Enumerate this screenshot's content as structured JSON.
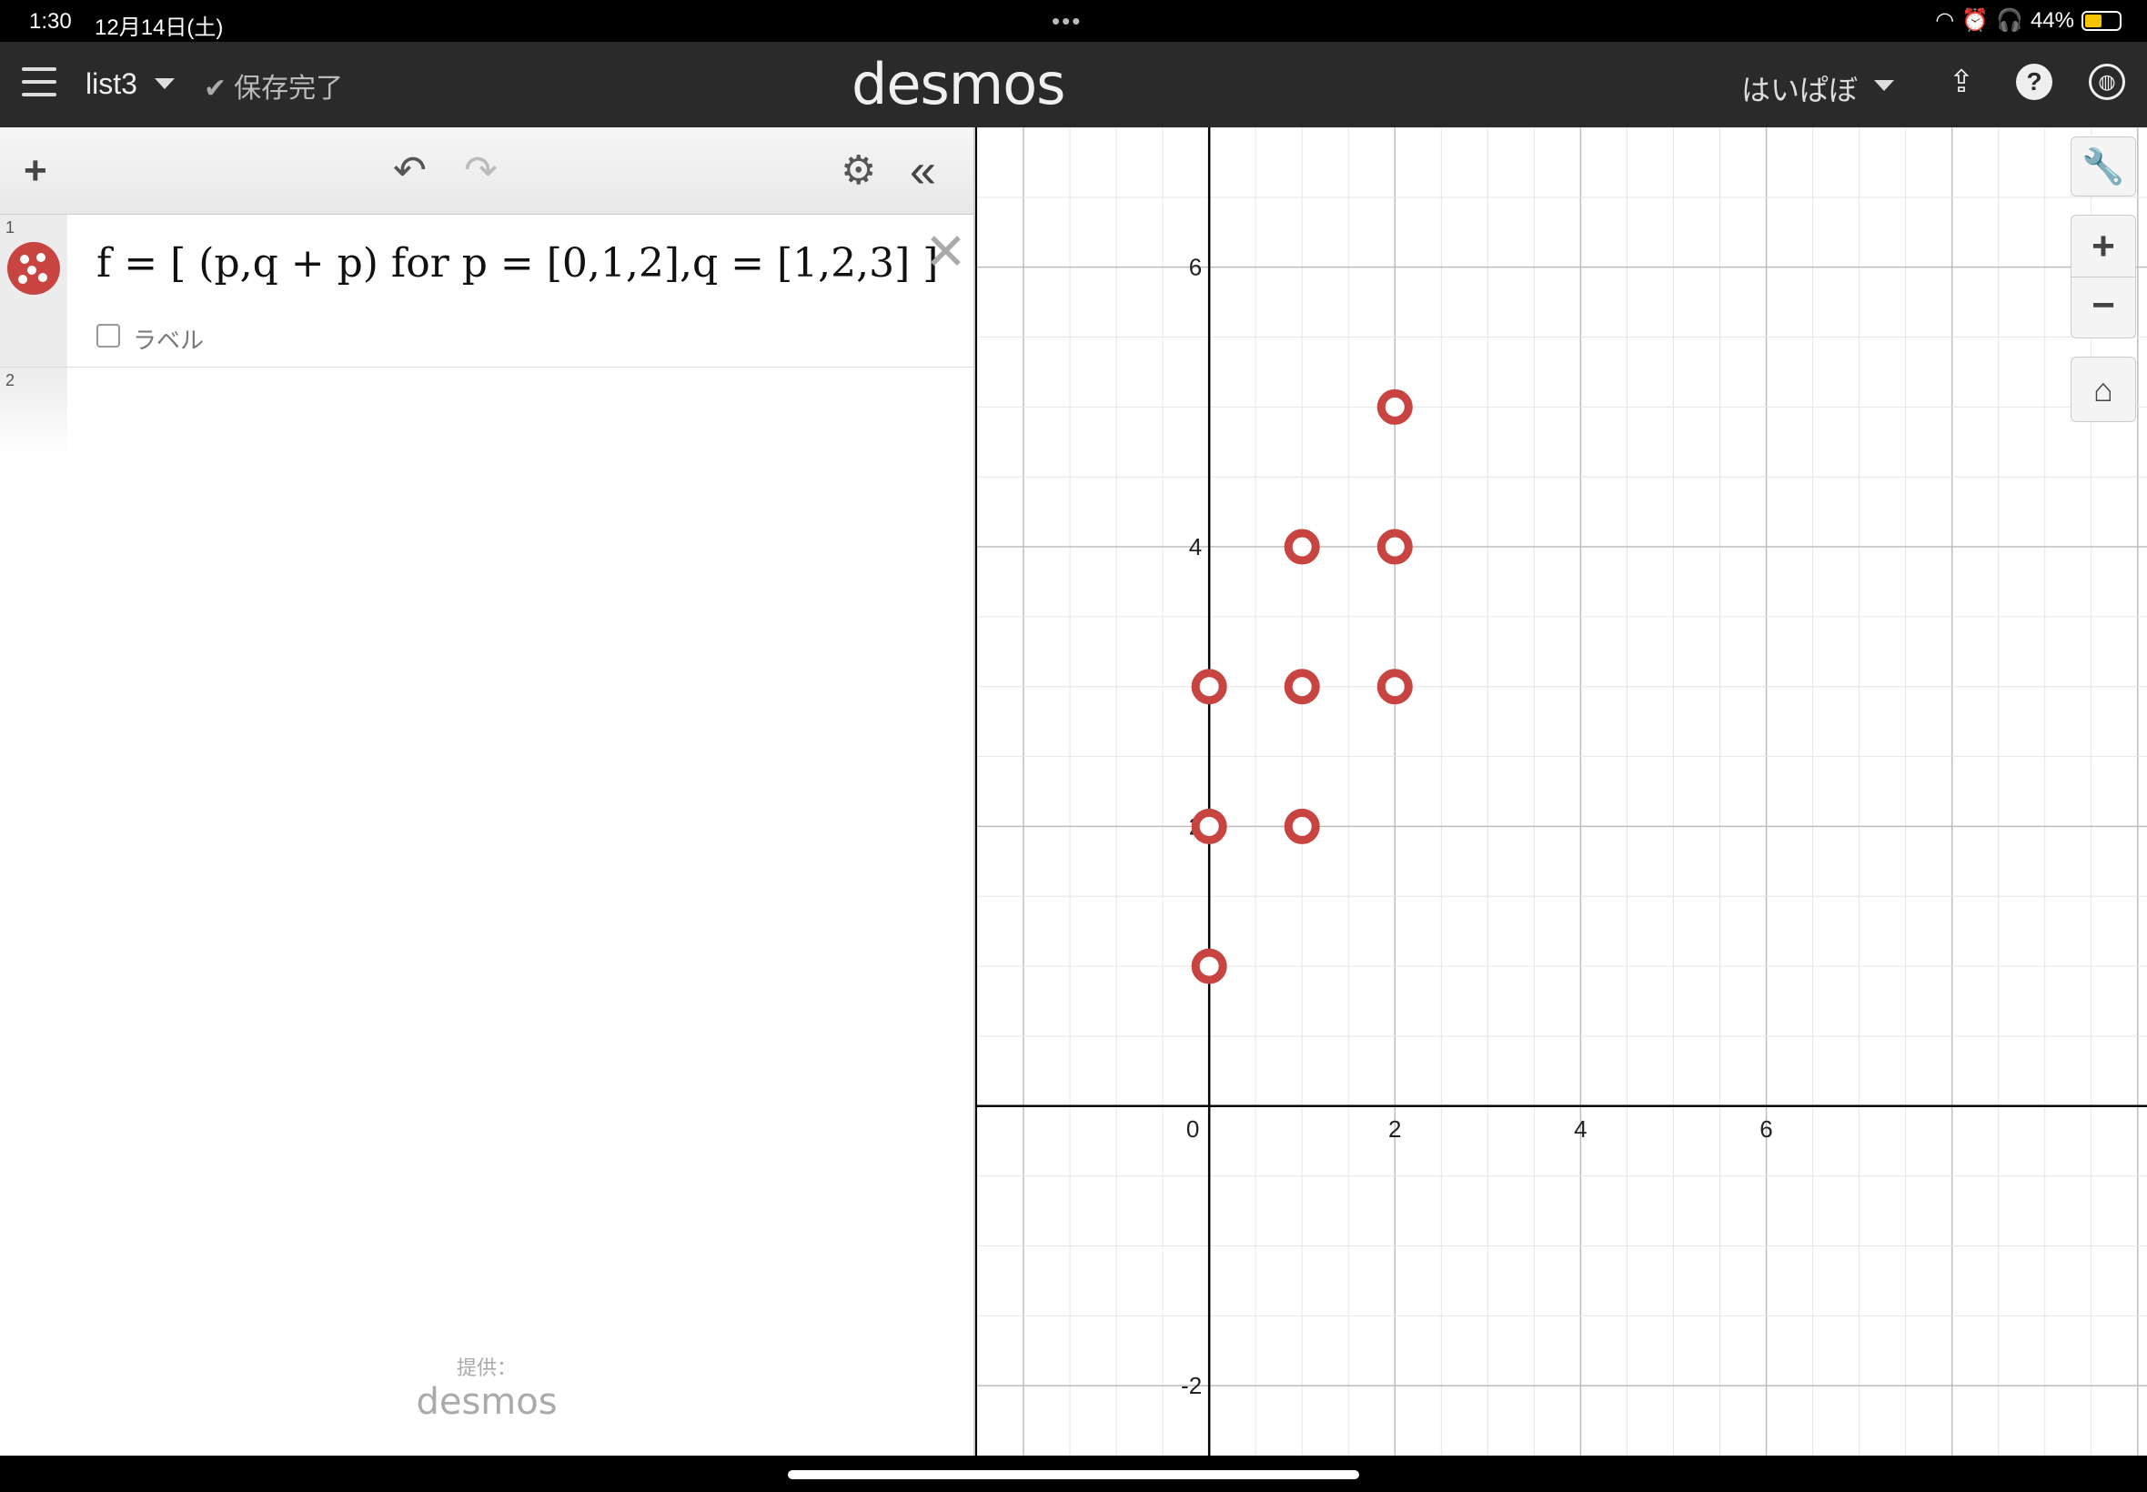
{
  "status_bar": {
    "time": "1:30",
    "date": "12月14日(土)",
    "battery": "44%"
  },
  "header": {
    "graph_title": "list3",
    "save_status": "保存完了",
    "logo": "desmos",
    "user_name": "はいぱぼ"
  },
  "expressions": {
    "items": [
      {
        "number": "1",
        "latex_display": "f = [ (p,q + p)  for  p = [0,1,2],q = [1,2,3] ]",
        "color": "#c74440",
        "label_checkbox": "ラベル"
      },
      {
        "number": "2"
      }
    ]
  },
  "footer": {
    "provided_by": "提供：",
    "logo": "desmos"
  },
  "graph": {
    "x_range": [
      -2.5,
      10.1
    ],
    "y_range": [
      -2.5,
      7.0
    ],
    "axis_color": "#000000",
    "grid_color": "#e6e6e6",
    "major_grid_color": "#bdbdbd",
    "x_tick_labels": [
      "0",
      "2",
      "4",
      "6"
    ],
    "y_tick_labels": [
      "-2",
      "2",
      "4",
      "6"
    ],
    "points": [
      {
        "x": 0,
        "y": 1
      },
      {
        "x": 0,
        "y": 2
      },
      {
        "x": 0,
        "y": 3
      },
      {
        "x": 1,
        "y": 2
      },
      {
        "x": 1,
        "y": 3
      },
      {
        "x": 1,
        "y": 4
      },
      {
        "x": 2,
        "y": 3
      },
      {
        "x": 2,
        "y": 4
      },
      {
        "x": 2,
        "y": 5
      }
    ],
    "point_color": "#c74440",
    "point_style": "open circle"
  }
}
